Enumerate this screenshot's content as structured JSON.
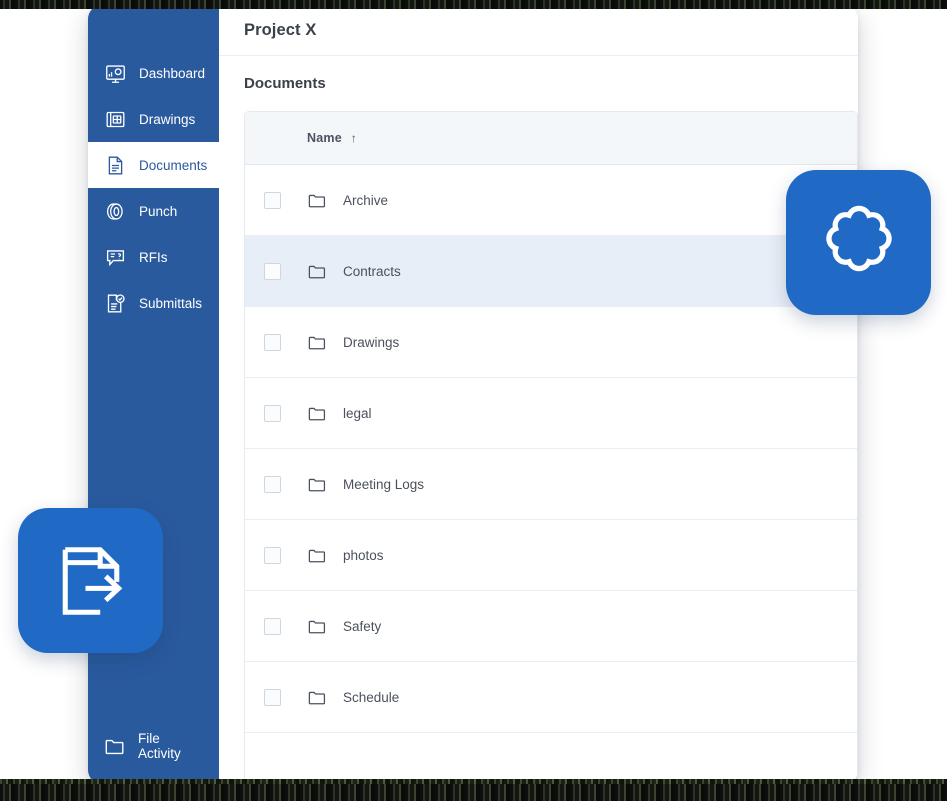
{
  "app": {
    "sidebar": {
      "items": [
        {
          "label": "Dashboard",
          "icon": "dashboard-icon",
          "active": false
        },
        {
          "label": "Drawings",
          "icon": "drawings-icon",
          "active": false
        },
        {
          "label": "Documents",
          "icon": "documents-icon",
          "active": true
        },
        {
          "label": "Punch",
          "icon": "punch-icon",
          "active": false
        },
        {
          "label": "RFIs",
          "icon": "rfis-icon",
          "active": false
        },
        {
          "label": "Submittals",
          "icon": "submittals-icon",
          "active": false
        }
      ],
      "bottom": {
        "label": "File Activity",
        "icon": "folder-open-icon"
      },
      "background_color": "#2a5a9e",
      "active_text_color": "#2a5a9e"
    },
    "header": {
      "project_title": "Project X"
    },
    "section": {
      "title": "Documents"
    },
    "table": {
      "columns": [
        {
          "key": "checkbox",
          "label": ""
        },
        {
          "key": "name",
          "label": "Name",
          "sort": "ascending",
          "sort_glyph": "↑"
        }
      ],
      "rows": [
        {
          "name": "Archive",
          "icon": "folder-icon",
          "checked": false,
          "selected": false
        },
        {
          "name": "Contracts",
          "icon": "folder-icon",
          "checked": false,
          "selected": true
        },
        {
          "name": "Drawings",
          "icon": "folder-icon",
          "checked": false,
          "selected": false
        },
        {
          "name": "legal",
          "icon": "folder-icon",
          "checked": false,
          "selected": false
        },
        {
          "name": "Meeting Logs",
          "icon": "folder-icon",
          "checked": false,
          "selected": false
        },
        {
          "name": "photos",
          "icon": "folder-icon",
          "checked": false,
          "selected": false
        },
        {
          "name": "Safety",
          "icon": "folder-icon",
          "checked": false,
          "selected": false
        },
        {
          "name": "Schedule",
          "icon": "folder-icon",
          "checked": false,
          "selected": false
        }
      ],
      "header_background": "#f4f7fa",
      "selected_row_background": "#e8eef7"
    },
    "tiles": [
      {
        "id": "cloud",
        "icon": "cloud-flower-icon",
        "color": "#2069c4"
      },
      {
        "id": "export",
        "icon": "document-export-icon",
        "color": "#2069c4"
      }
    ]
  }
}
